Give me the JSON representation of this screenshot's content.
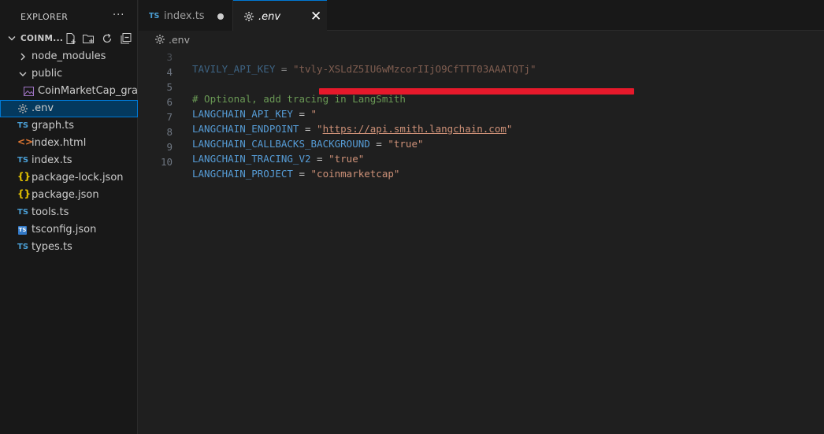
{
  "sidebar": {
    "title": "EXPLORER",
    "more": "···",
    "root": {
      "name": "COINM...",
      "actions": [
        "new-file",
        "new-folder",
        "refresh",
        "collapse"
      ]
    },
    "items": [
      {
        "label": "node_modules",
        "icon": "chevron-right-icon"
      },
      {
        "label": "public",
        "icon": "chevron-down-icon"
      },
      {
        "label": "CoinMarketCap_gra...",
        "icon": "image-icon"
      },
      {
        "label": ".env",
        "icon": "gear-icon"
      },
      {
        "label": "graph.ts",
        "icon": "TS"
      },
      {
        "label": "index.html",
        "icon": "<>"
      },
      {
        "label": "index.ts",
        "icon": "TS"
      },
      {
        "label": "package-lock.json",
        "icon": "{}"
      },
      {
        "label": "package.json",
        "icon": "{}"
      },
      {
        "label": "tools.ts",
        "icon": "TS"
      },
      {
        "label": "tsconfig.json",
        "icon": "TS"
      },
      {
        "label": "types.ts",
        "icon": "TS"
      }
    ]
  },
  "tabs": [
    {
      "label": "index.ts",
      "badge": "TS",
      "modified": true
    },
    {
      "label": ".env",
      "close": "✕"
    }
  ],
  "breadcrumb": {
    "label": ".env"
  },
  "editor": {
    "lines": [
      {
        "n": "3",
        "key": "TAVILY_API_KEY",
        "eq": " = ",
        "val": "\"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\""
      },
      {
        "n": "4"
      },
      {
        "n": "5",
        "comment": "# Optional, add tracing in LangSmith"
      },
      {
        "n": "6",
        "key": "LANGCHAIN_API_KEY",
        "eq": " = ",
        "val": "\""
      },
      {
        "n": "7",
        "key": "LANGCHAIN_ENDPOINT",
        "eq": " = ",
        "q1": "\"",
        "url": "https://api.smith.langchain.com",
        "q2": "\""
      },
      {
        "n": "8",
        "key": "LANGCHAIN_CALLBACKS_BACKGROUND",
        "eq": " = ",
        "val": "\"true\""
      },
      {
        "n": "9",
        "key": "LANGCHAIN_TRACING_V2",
        "eq": " = ",
        "val": "\"true\""
      },
      {
        "n": "10",
        "key": "LANGCHAIN_PROJECT",
        "eq": " = ",
        "val": "\"coinmarketcap\""
      }
    ]
  },
  "colors": {
    "accent": "#0078d4",
    "redaction": "#e6192b",
    "keyword": "#569cd6",
    "string": "#ce9178",
    "comment": "#6a9955"
  }
}
